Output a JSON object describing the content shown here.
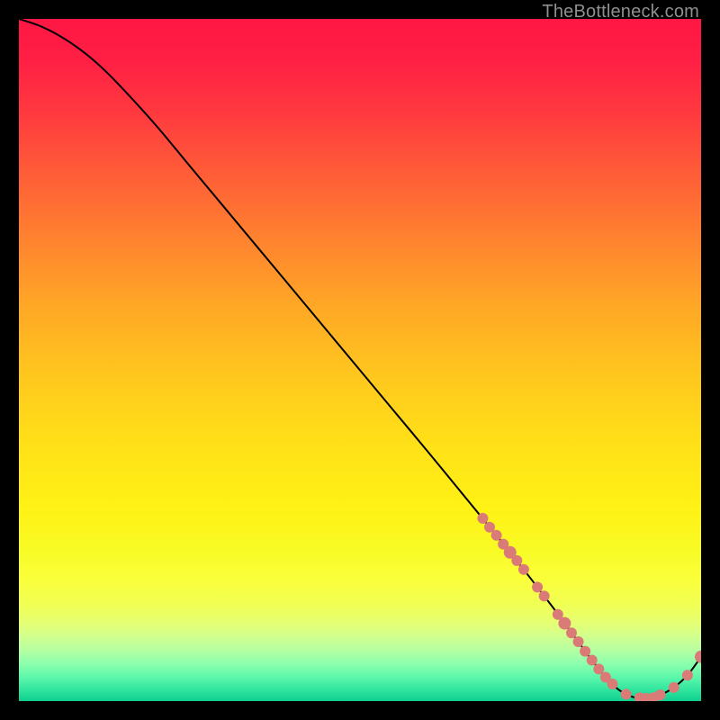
{
  "attribution": "TheBottleneck.com",
  "colors": {
    "marker": "#db7b77",
    "curve": "#000000",
    "gradient_stops": [
      {
        "offset": 0.0,
        "color": "#ff1744"
      },
      {
        "offset": 0.06,
        "color": "#ff1f44"
      },
      {
        "offset": 0.14,
        "color": "#ff3a3f"
      },
      {
        "offset": 0.22,
        "color": "#ff5a38"
      },
      {
        "offset": 0.32,
        "color": "#ff812f"
      },
      {
        "offset": 0.42,
        "color": "#ffa726"
      },
      {
        "offset": 0.52,
        "color": "#ffc61e"
      },
      {
        "offset": 0.62,
        "color": "#ffe018"
      },
      {
        "offset": 0.72,
        "color": "#fff215"
      },
      {
        "offset": 0.78,
        "color": "#f8fb26"
      },
      {
        "offset": 0.82,
        "color": "#fbff3a"
      },
      {
        "offset": 0.86,
        "color": "#f0ff55"
      },
      {
        "offset": 0.885,
        "color": "#e6ff73"
      },
      {
        "offset": 0.905,
        "color": "#d2ff8e"
      },
      {
        "offset": 0.925,
        "color": "#b6ffa2"
      },
      {
        "offset": 0.945,
        "color": "#8cffad"
      },
      {
        "offset": 0.965,
        "color": "#5cf7ab"
      },
      {
        "offset": 0.985,
        "color": "#2de39d"
      },
      {
        "offset": 1.0,
        "color": "#0fce8f"
      }
    ]
  },
  "chart_data": {
    "type": "line",
    "title": "",
    "xlabel": "",
    "ylabel": "",
    "xlim": [
      0,
      100
    ],
    "ylim": [
      0,
      100
    ],
    "series": [
      {
        "name": "bottleneck-curve",
        "x": [
          0,
          3,
          6,
          9,
          12,
          15,
          20,
          25,
          30,
          35,
          40,
          45,
          50,
          55,
          60,
          65,
          70,
          72,
          75,
          78,
          80,
          82,
          84,
          86,
          88,
          90,
          92,
          94,
          96,
          98,
          100
        ],
        "y": [
          100,
          99,
          97.5,
          95.5,
          93,
          90,
          84.5,
          78.5,
          72.5,
          66.5,
          60.5,
          54.5,
          48.5,
          42.5,
          36.5,
          30.4,
          24.3,
          21.8,
          18,
          14.1,
          11.4,
          8.7,
          6.0,
          3.5,
          1.6,
          0.6,
          0.4,
          0.9,
          2.0,
          3.8,
          6.5
        ]
      }
    ],
    "markers": {
      "name": "highlight-points",
      "x": [
        68,
        69,
        70,
        71,
        72,
        73,
        74,
        76,
        77,
        79,
        80,
        81,
        82,
        83,
        84,
        85,
        86,
        87,
        89,
        91,
        92,
        93,
        94,
        96,
        98,
        100
      ],
      "y": [
        26.8,
        25.5,
        24.3,
        23.0,
        21.8,
        20.6,
        19.3,
        16.7,
        15.4,
        12.7,
        11.4,
        10.0,
        8.7,
        7.3,
        6.0,
        4.7,
        3.5,
        2.5,
        1.0,
        0.5,
        0.4,
        0.5,
        0.9,
        2.0,
        3.8,
        6.5
      ],
      "r": [
        6,
        6,
        6,
        6,
        7,
        6,
        6,
        6,
        6,
        6,
        7,
        6,
        6,
        6,
        6,
        6,
        6,
        6,
        6,
        6,
        6,
        6,
        6,
        6,
        6,
        7
      ]
    }
  }
}
